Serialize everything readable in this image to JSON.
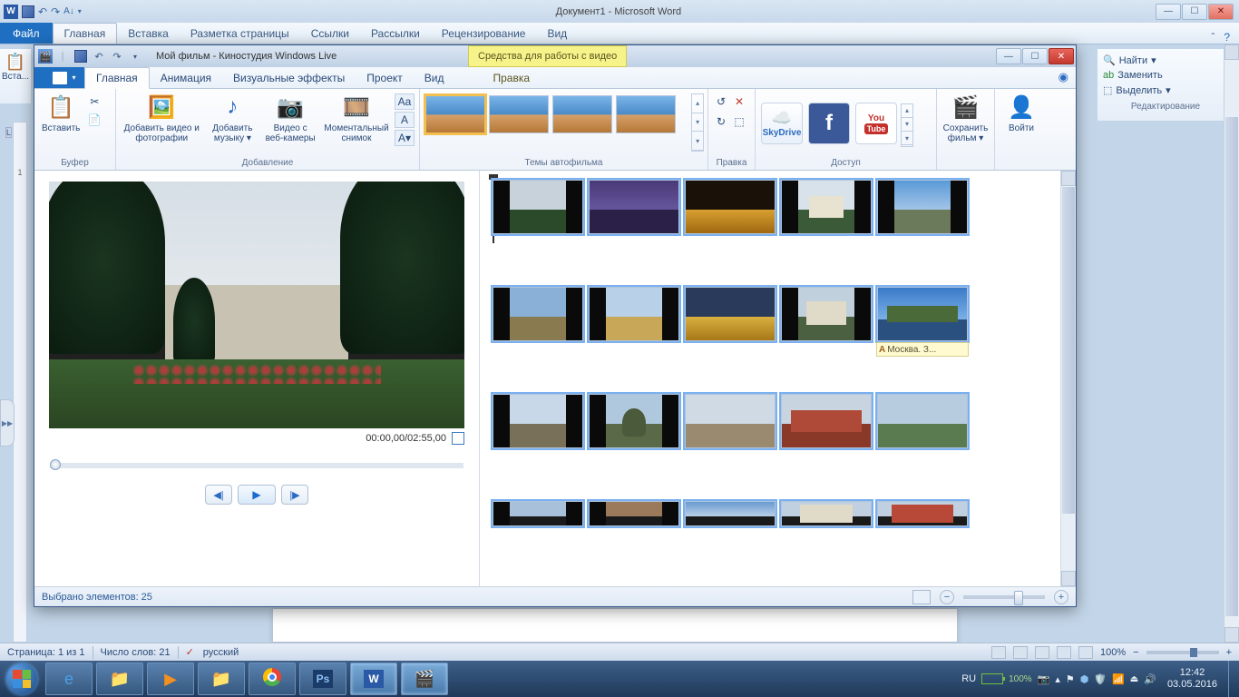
{
  "word": {
    "title": "Документ1 - Microsoft Word",
    "file_tab": "Файл",
    "tabs": [
      "Главная",
      "Вставка",
      "Разметка страницы",
      "Ссылки",
      "Рассылки",
      "Рецензирование",
      "Вид"
    ],
    "insert_btn": "Вста...",
    "find": "Найти",
    "replace": "Заменить",
    "select": "Выделить",
    "editing_grp": "Редактирование",
    "status_page": "Страница: 1 из 1",
    "status_words": "Число слов: 21",
    "status_lang": "русский",
    "zoom": "100%"
  },
  "mm": {
    "title": "Мой фильм - Киностудия Windows Live",
    "context_tab_header": "Средства для работы с видео",
    "tabs": {
      "home": "Главная",
      "anim": "Анимация",
      "fx": "Визуальные эффекты",
      "proj": "Проект",
      "view": "Вид",
      "edit": "Правка"
    },
    "groups": {
      "buffer": "Буфер",
      "add": "Добавление",
      "themes": "Темы автофильма",
      "edit": "Правка",
      "share": "Доступ"
    },
    "btn_paste": "Вставить",
    "btn_add_media": "Добавить видео и фотографии",
    "btn_add_music": "Добавить музыку",
    "btn_webcam": "Видео с веб-камеры",
    "btn_snapshot": "Моментальный снимок",
    "btn_skydrive": "SkyDrive",
    "btn_save": "Сохранить фильм",
    "btn_signin": "Войти",
    "youtube_top": "You",
    "youtube_bottom": "Tube",
    "timecode": "00:00,00/02:55,00",
    "caption_text": "Москва. З...",
    "status_selected": "Выбрано элементов: 25"
  },
  "taskbar": {
    "lang": "RU",
    "battery": "100%",
    "time": "12:42",
    "date": "03.05.2016"
  }
}
